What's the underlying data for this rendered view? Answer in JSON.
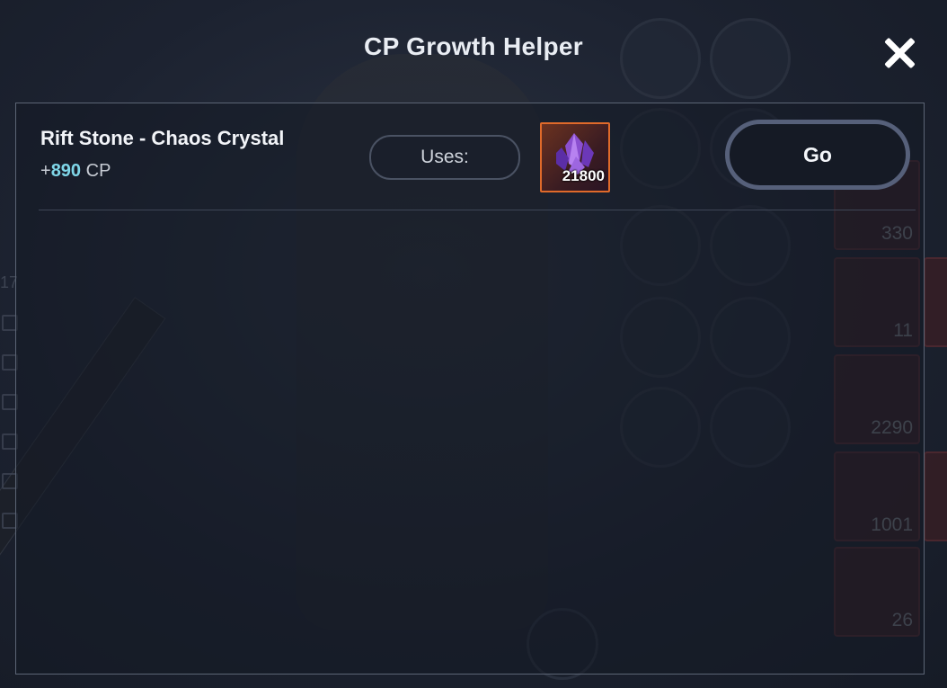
{
  "modal": {
    "title": "CP Growth Helper",
    "close_icon": "close-icon"
  },
  "rows": [
    {
      "name": "Rift Stone - Chaos Crystal",
      "cp_prefix": "+",
      "cp_value": "890",
      "cp_unit": "CP",
      "uses_label": "Uses:",
      "item_icon": "chaos-crystal-icon",
      "item_quantity": "21800",
      "action_label": "Go"
    }
  ],
  "background": {
    "inventory_counts": [
      "330",
      "11",
      "2290",
      "1001",
      "26"
    ],
    "side_number": "17"
  },
  "colors": {
    "cp_value": "#7fd6e8",
    "item_border": "#e06a2a",
    "button_border": "#56607a"
  }
}
